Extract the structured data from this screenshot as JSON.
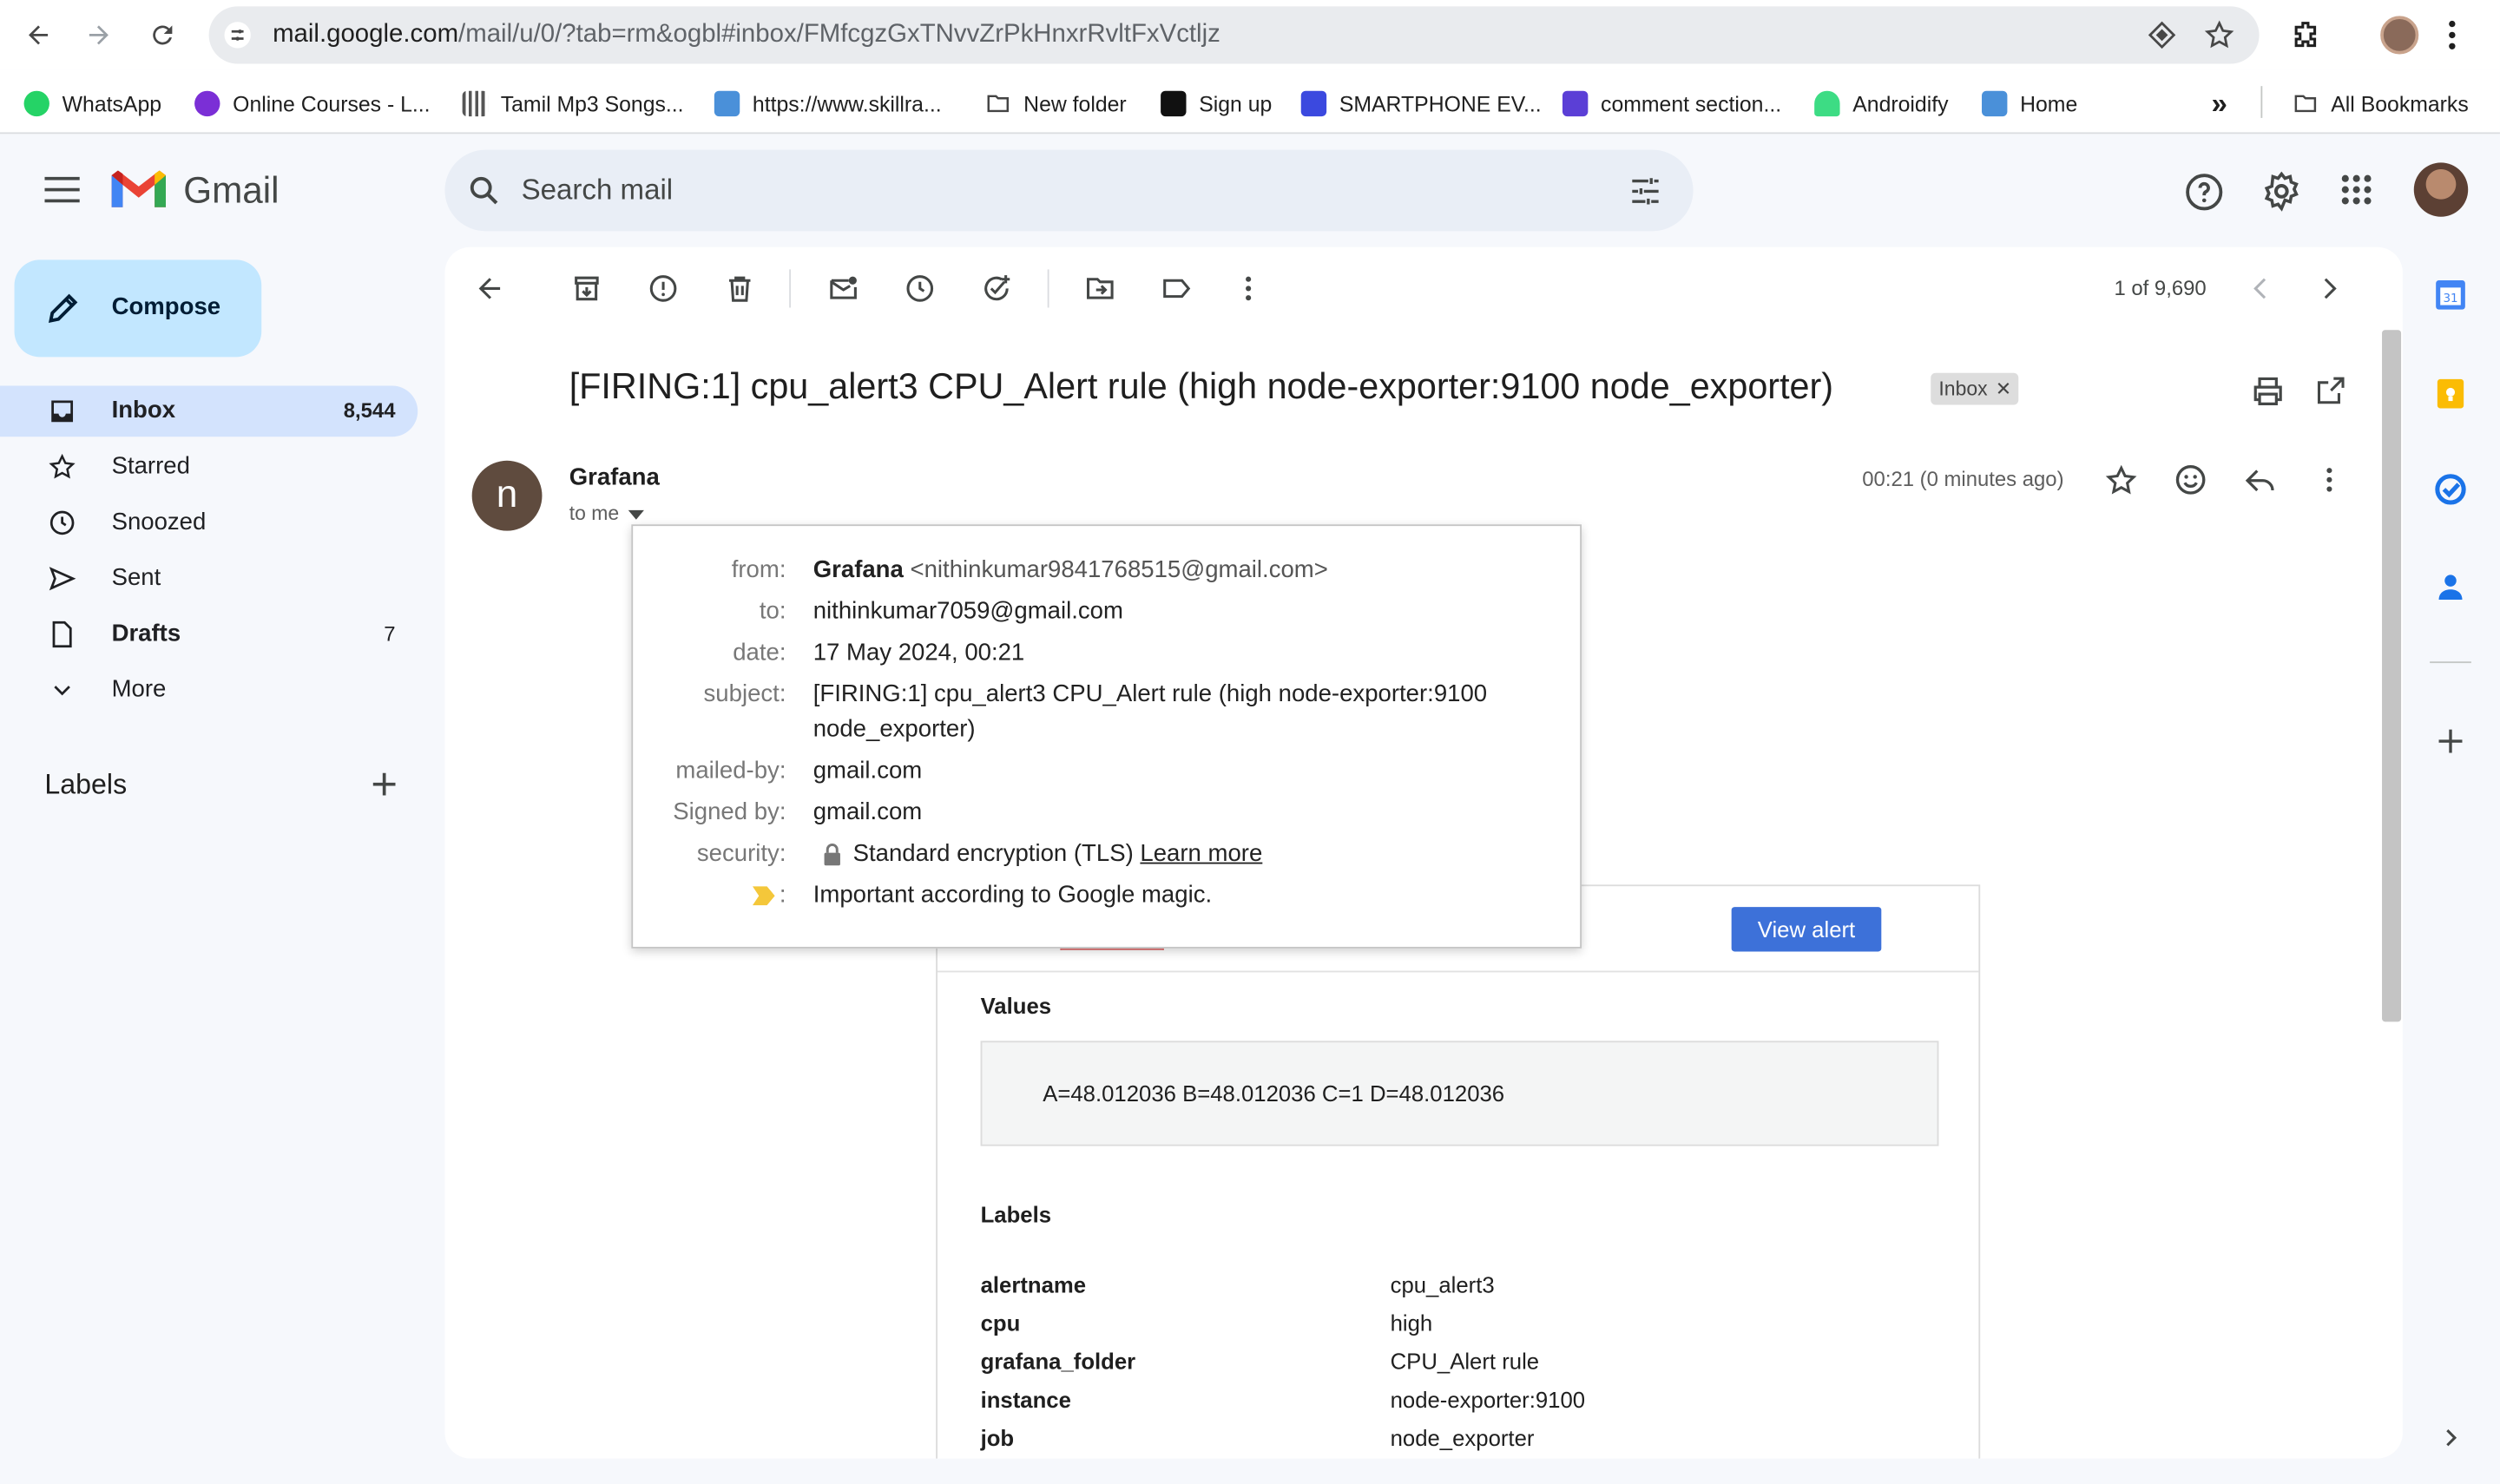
{
  "browser": {
    "url_host": "mail.google.com",
    "url_path": "/mail/u/0/?tab=rm&ogbl#inbox/FMfcgzGxTNvvZrPkHnxrRvltFxVctljz",
    "bookmarks": [
      {
        "label": "WhatsApp",
        "color": "#25d366"
      },
      {
        "label": "Online Courses - L...",
        "color": "#7b2fd6"
      },
      {
        "label": "Tamil Mp3 Songs...",
        "color": "#555555"
      },
      {
        "label": "https://www.skillra...",
        "color": "#4a90d9"
      },
      {
        "label": "New folder",
        "color": "#5f6368"
      },
      {
        "label": "Sign up",
        "color": "#111111"
      },
      {
        "label": "SMARTPHONE EV...",
        "color": "#3b49df"
      },
      {
        "label": "comment section...",
        "color": "#5b3fd6"
      },
      {
        "label": "Androidify",
        "color": "#3ddc84"
      },
      {
        "label": "Home",
        "color": "#4a90d9"
      }
    ],
    "all_bookmarks": "All Bookmarks"
  },
  "gmail": {
    "logo_text": "Gmail",
    "search_placeholder": "Search mail",
    "compose_label": "Compose",
    "nav": [
      {
        "label": "Inbox",
        "count": "8,544",
        "icon": "inbox-icon"
      },
      {
        "label": "Starred",
        "count": "",
        "icon": "star-icon"
      },
      {
        "label": "Snoozed",
        "count": "",
        "icon": "clock-icon"
      },
      {
        "label": "Sent",
        "count": "",
        "icon": "send-icon"
      },
      {
        "label": "Drafts",
        "count": "7",
        "icon": "draft-icon"
      },
      {
        "label": "More",
        "count": "",
        "icon": "chevron-down-icon"
      }
    ],
    "labels_heading": "Labels",
    "pagination": "1 of 9,690"
  },
  "email": {
    "subject": "[FIRING:1] cpu_alert3 CPU_Alert rule (high node-exporter:9100 node_exporter)",
    "inbox_chip": "Inbox",
    "avatar_letter": "n",
    "sender": "Grafana",
    "to_me": "to me",
    "time": "00:21 (0 minutes ago)",
    "view_alert": "View alert",
    "values_heading": "Values",
    "values_text": "A=48.012036  B=48.012036  C=1  D=48.012036",
    "labels_heading": "Labels",
    "labels": [
      {
        "key": "alertname",
        "value": "cpu_alert3"
      },
      {
        "key": "cpu",
        "value": "high"
      },
      {
        "key": "grafana_folder",
        "value": "CPU_Alert rule"
      },
      {
        "key": "instance",
        "value": "node-exporter:9100"
      },
      {
        "key": "job",
        "value": "node_exporter"
      }
    ]
  },
  "details_popup": {
    "from_key": "from:",
    "from_name": "Grafana",
    "from_email": "<nithinkumar9841768515@gmail.com>",
    "to_key": "to:",
    "to_value": "nithinkumar7059@gmail.com",
    "date_key": "date:",
    "date_value": "17 May 2024, 00:21",
    "subject_key": "subject:",
    "subject_line1": "[FIRING:1] cpu_alert3 CPU_Alert rule (high node-exporter:9100",
    "subject_line2": "node_exporter)",
    "mailedby_key": "mailed-by:",
    "mailedby_value": "gmail.com",
    "signedby_key": "Signed by:",
    "signedby_value": "gmail.com",
    "security_key": "security:",
    "security_value": "Standard encryption (TLS)",
    "learn_more": "Learn more",
    "important_key": ":",
    "important_value": "Important according to Google magic."
  }
}
